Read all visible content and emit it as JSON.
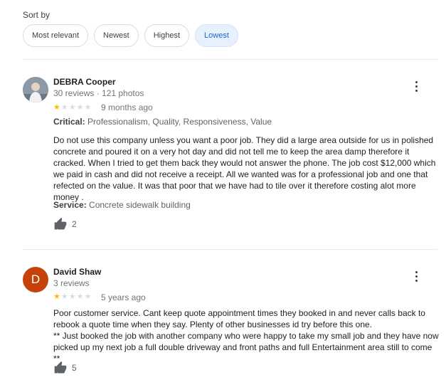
{
  "sort": {
    "label": "Sort by",
    "options": [
      "Most relevant",
      "Newest",
      "Highest",
      "Lowest"
    ],
    "selected": "Lowest"
  },
  "reviews": [
    {
      "name": "DEBRA Cooper",
      "meta": "30 reviews · 121 photos",
      "rating": 1,
      "max_rating": 5,
      "time": "9 months ago",
      "critical_label": "Critical:",
      "critical_values": "Professionalism, Quality, Responsiveness, Value",
      "text": "Do not use this company unless you want a poor job. They did a large area outside for us in polished concrete and poured it on a very hot day and did not tell me to keep the area damp therefore it cracked. When I tried to get them back they would not answer the phone. The job cost $12,000 which we paid in cash and did not receive a receipt. All we wanted was for a professional job and one that refected on the value. It was that poor that we have had to tile over it therefore costing alot more money .",
      "service_label": "Service:",
      "service_value": "Concrete sidewalk building",
      "likes": "2",
      "avatar": "photo"
    },
    {
      "name": "David Shaw",
      "meta": "3 reviews",
      "rating": 1,
      "max_rating": 5,
      "time": "5 years ago",
      "text": "Poor customer service. Cant keep quote appointment times they booked in and never calls back to rebook a quote time when they say. Plenty of other businesses id try before this one.\n** Just booked the job with another company who were happy to take my small job and they have now picked up my next job a full double driveway and front paths and full Entertainment area still to come **",
      "likes": "5",
      "avatar_letter": "D",
      "avatar_color": "#c5420a"
    }
  ],
  "icons": {
    "more": "more-vert-icon",
    "like": "thumb-up-icon",
    "star": "star-icon"
  }
}
